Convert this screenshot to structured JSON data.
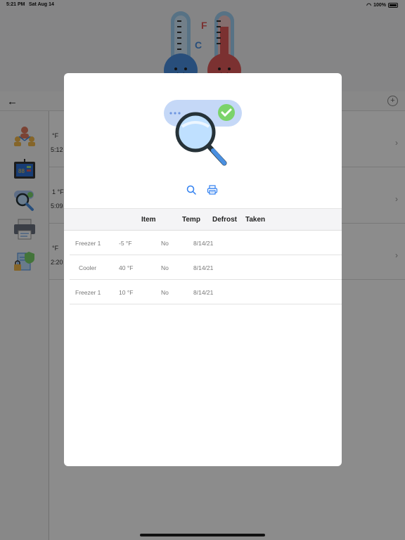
{
  "status_bar": {
    "time": "5:21 PM",
    "date": "Sat Aug 14",
    "battery": "100%"
  },
  "hero": {
    "units_f": "F",
    "units_c": "C"
  },
  "list": [
    {
      "line1": "°F",
      "line2": "5:12"
    },
    {
      "line1": "1 °F",
      "line2": "5:09"
    },
    {
      "line1": "°F",
      "line2": "2:20"
    }
  ],
  "icons": {
    "back": "arrow-left-icon",
    "add": "plus-circle-icon",
    "sidebar": [
      "team-icon",
      "thermostat-display-icon",
      "inspect-icon",
      "printer-icon",
      "secure-document-icon"
    ],
    "actions": [
      "search-icon",
      "print-icon"
    ]
  },
  "table": {
    "headers": {
      "item": "Item",
      "temp": "Temp",
      "defrost": "Defrost",
      "taken": "Taken"
    },
    "rows": [
      {
        "item": "Freezer 1",
        "temp": "-5 °F",
        "defrost": "No",
        "taken": "8/14/21"
      },
      {
        "item": "Cooler",
        "temp": "40 °F",
        "defrost": "No",
        "taken": "8/14/21"
      },
      {
        "item": "Freezer 1",
        "temp": "10 °F",
        "defrost": "No",
        "taken": "8/14/21"
      }
    ]
  },
  "colors": {
    "accent": "#2f7ff0",
    "cold": "#4a8fe0",
    "hot": "#e05a5a"
  }
}
